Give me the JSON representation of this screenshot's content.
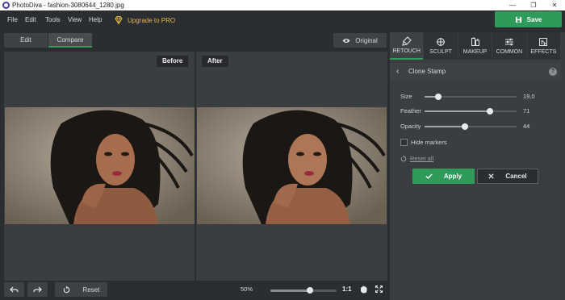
{
  "window": {
    "title": "PhotoDiva - fashion-3080644_1280.jpg",
    "controls": [
      "—",
      "❐",
      "✕"
    ]
  },
  "menu": {
    "items": [
      "File",
      "Edit",
      "Tools",
      "View",
      "Help"
    ],
    "upgrade_label": "Upgrade to PRO"
  },
  "toolbar": {
    "save_label": "Save"
  },
  "view_tabs": [
    {
      "label": "Edit",
      "active": false
    },
    {
      "label": "Compare",
      "active": true
    }
  ],
  "original_label": "Original",
  "panes": {
    "before_label": "Before",
    "after_label": "After"
  },
  "bottom": {
    "reset_label": "Reset",
    "zoom_text": "50%",
    "zoom_level": 0.6,
    "one_to_one": "1:1"
  },
  "tools": [
    {
      "label": "RETOUCH",
      "icon": "retouch-brush-icon",
      "active": true
    },
    {
      "label": "SCULPT",
      "icon": "sculpt-crosshair-icon",
      "active": false
    },
    {
      "label": "MAKEUP",
      "icon": "makeup-icon",
      "active": false
    },
    {
      "label": "COMMON",
      "icon": "sliders-icon",
      "active": false
    },
    {
      "label": "EFFECTS",
      "icon": "effects-icon",
      "active": false
    }
  ],
  "clone_stamp": {
    "title": "Clone Stamp",
    "help": "?",
    "sliders": [
      {
        "label": "Size",
        "value_text": "19,0",
        "level": 0.15
      },
      {
        "label": "Feather",
        "value_text": "71",
        "level": 0.71
      },
      {
        "label": "Opacity",
        "value_text": "44",
        "level": 0.44
      }
    ],
    "hide_markers_label": "Hide markers",
    "reset_all_label": "Reset all",
    "apply_label": "Apply",
    "cancel_label": "Cancel"
  },
  "colors": {
    "accent_green": "#2f9b5a",
    "pro_gold": "#e4b84a",
    "panel_bg": "#3a3d41",
    "app_bg": "#2b2e31"
  }
}
